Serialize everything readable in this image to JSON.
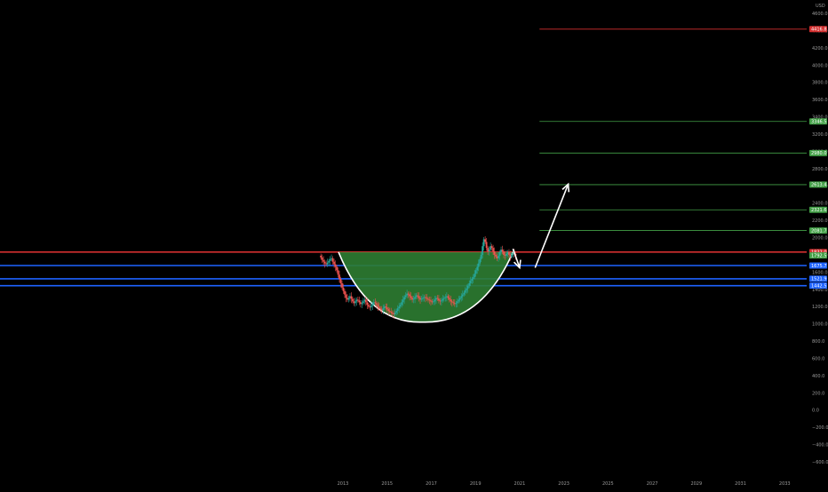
{
  "chart_data": {
    "type": "candlestick",
    "currency": "USD",
    "ylim": [
      -600,
      4600
    ],
    "xlim": [
      2011.0,
      2033.0
    ],
    "y_ticks": [
      "4600.0",
      "4400.0",
      "4200.0",
      "4000.0",
      "3800.0",
      "3600.0",
      "3400.0",
      "3200.0",
      "3000.0",
      "2800.0",
      "2600.0",
      "2400.0",
      "2200.0",
      "2000.0",
      "1800.0",
      "1600.0",
      "1400.0",
      "1200.0",
      "1000.0",
      "800.0",
      "600.0",
      "400.0",
      "200.0",
      "0.0",
      "−200.0",
      "−400.0",
      "−600.0"
    ],
    "x_ticks": [
      "2013",
      "2015",
      "2017",
      "2019",
      "2021",
      "2023",
      "2025",
      "2027",
      "2029",
      "2031",
      "2033"
    ],
    "price_tags": [
      {
        "value": 4416.8,
        "label": "4416.8",
        "color": "#d32f2f",
        "line": true,
        "line_from": 2021.9
      },
      {
        "value": 3346.5,
        "label": "3346.5",
        "color": "#43a047",
        "line": true,
        "line_from": 2021.9
      },
      {
        "value": 2980.0,
        "label": "2980.0",
        "color": "#43a047",
        "line": true,
        "line_from": 2021.9
      },
      {
        "value": 2613.4,
        "label": "2613.4",
        "color": "#43a047",
        "line": true,
        "line_from": 2021.9
      },
      {
        "value": 2321.6,
        "label": "2321.6",
        "color": "#43a047",
        "line": true,
        "line_from": 2021.9
      },
      {
        "value": 2081.7,
        "label": "2081.7",
        "color": "#43a047",
        "line": true,
        "line_from": 2021.9
      },
      {
        "value": 1832.0,
        "label": "1832.0",
        "color": "#d32f2f",
        "line": true,
        "line_from": 2011.0
      },
      {
        "value": 1792.5,
        "label": "1792.5",
        "color": "#43a047",
        "line": false,
        "line_from": 2011.0
      },
      {
        "value": 1675.7,
        "label": "1675.7",
        "color": "#1e63ff",
        "line": true,
        "line_from": 2011.0
      },
      {
        "value": 1521.9,
        "label": "1521.9",
        "color": "#1e63ff",
        "line": true,
        "line_from": 2011.0
      },
      {
        "value": 1442.5,
        "label": "1442.5",
        "color": "#1e63ff",
        "line": true,
        "line_from": 2011.0
      }
    ],
    "cup": {
      "rim_left": [
        2012.8,
        1832.0
      ],
      "rim_right": [
        2020.7,
        1832.0
      ],
      "bottom": [
        2016.6,
        1020.0
      ]
    },
    "arrows": [
      {
        "points": [
          [
            2020.7,
            1870.0
          ],
          [
            2021.0,
            1650.0
          ]
        ],
        "head": true
      },
      {
        "points": [
          [
            2021.7,
            1650.0
          ],
          [
            2023.2,
            2620.0
          ]
        ],
        "head": true
      }
    ],
    "candles": {
      "start": 2012.0,
      "step": 0.06,
      "closes": [
        1770,
        1740,
        1720,
        1700,
        1690,
        1710,
        1730,
        1750,
        1760,
        1720,
        1690,
        1660,
        1620,
        1570,
        1520,
        1470,
        1420,
        1380,
        1340,
        1300,
        1280,
        1300,
        1320,
        1290,
        1260,
        1240,
        1260,
        1280,
        1270,
        1250,
        1230,
        1240,
        1260,
        1280,
        1250,
        1220,
        1200,
        1190,
        1210,
        1230,
        1250,
        1240,
        1220,
        1200,
        1180,
        1170,
        1160,
        1180,
        1200,
        1190,
        1170,
        1150,
        1140,
        1130,
        1120,
        1110,
        1130,
        1150,
        1180,
        1200,
        1220,
        1250,
        1280,
        1310,
        1330,
        1350,
        1340,
        1320,
        1300,
        1280,
        1290,
        1310,
        1330,
        1320,
        1300,
        1280,
        1290,
        1300,
        1310,
        1300,
        1290,
        1280,
        1270,
        1260,
        1250,
        1260,
        1280,
        1300,
        1290,
        1270,
        1260,
        1270,
        1290,
        1300,
        1310,
        1320,
        1300,
        1280,
        1260,
        1250,
        1240,
        1230,
        1240,
        1260,
        1280,
        1300,
        1320,
        1340,
        1360,
        1390,
        1410,
        1440,
        1470,
        1500,
        1520,
        1540,
        1580,
        1620,
        1660,
        1700,
        1750,
        1800,
        1900,
        1980,
        1950,
        1880,
        1840,
        1860,
        1900,
        1880,
        1840,
        1800,
        1780,
        1760,
        1790,
        1830,
        1860,
        1840,
        1800,
        1790,
        1810,
        1830,
        1800,
        1780,
        1800,
        1820,
        1810,
        1790
      ]
    }
  }
}
